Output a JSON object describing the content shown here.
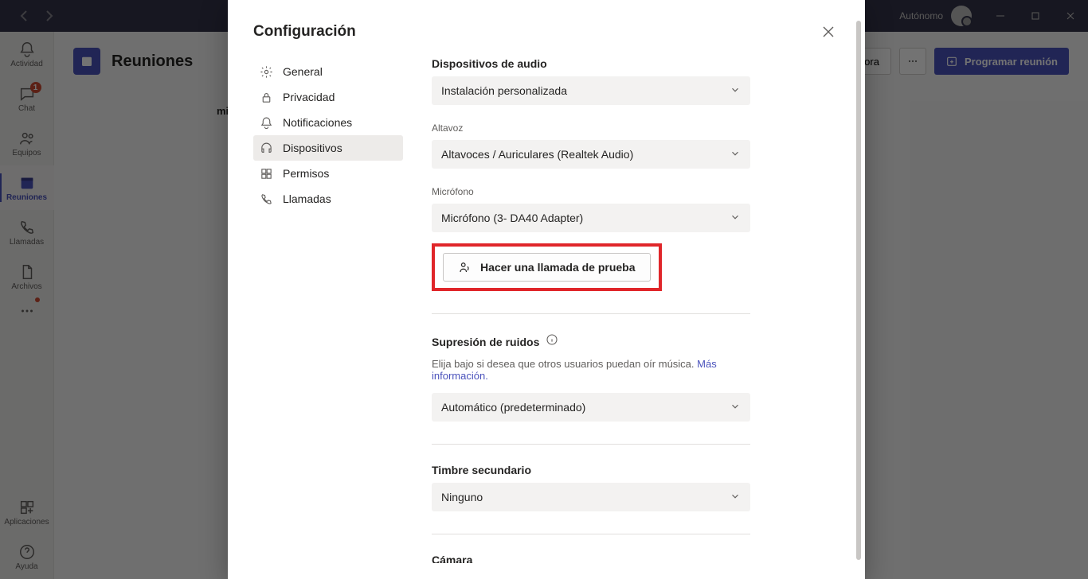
{
  "titlebar": {
    "user_label": "Autónomo"
  },
  "rail": {
    "items": [
      {
        "label": "Actividad"
      },
      {
        "label": "Chat",
        "badge": "1"
      },
      {
        "label": "Equipos"
      },
      {
        "label": "Reuniones"
      },
      {
        "label": "Llamadas"
      },
      {
        "label": "Archivos"
      }
    ],
    "apps_label": "Aplicaciones",
    "help_label": "Ayuda"
  },
  "page": {
    "title": "Reuniones",
    "date_fragment": "mié",
    "meet_now": "Reunirse ahora",
    "schedule": "Programar reunión"
  },
  "modal": {
    "title": "Configuración",
    "nav": {
      "general": "General",
      "privacy": "Privacidad",
      "notifications": "Notificaciones",
      "devices": "Dispositivos",
      "permissions": "Permisos",
      "calls": "Llamadas"
    },
    "devices": {
      "audio_header": "Dispositivos de audio",
      "audio_setup_value": "Instalación personalizada",
      "speaker_label": "Altavoz",
      "speaker_value": "Altavoces / Auriculares (Realtek Audio)",
      "mic_label": "Micrófono",
      "mic_value": "Micrófono (3- DA40 Adapter)",
      "test_call": "Hacer una llamada de prueba",
      "noise_header": "Supresión de ruidos",
      "noise_desc": "Elija bajo si desea que otros usuarios puedan oír música.",
      "noise_more": "Más información.",
      "noise_value": "Automático (predeterminado)",
      "ringer_header": "Timbre secundario",
      "ringer_value": "Ninguno",
      "camera_header": "Cámara"
    }
  }
}
